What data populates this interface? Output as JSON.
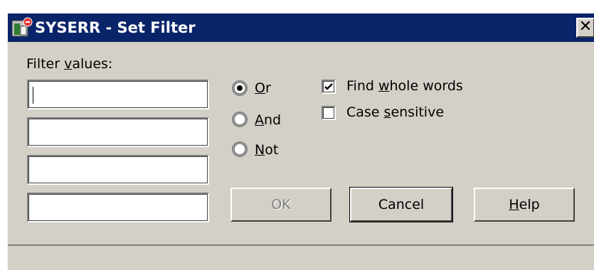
{
  "window": {
    "title": "SYSERR - Set Filter",
    "close_symbol": "✕",
    "icon": "app-icon"
  },
  "filter": {
    "label_prefix": "Filter ",
    "label_access": "v",
    "label_suffix": "alues:",
    "values": [
      "",
      "",
      "",
      ""
    ]
  },
  "logic": {
    "options": [
      {
        "access": "O",
        "rest": "r",
        "checked": true
      },
      {
        "access": "A",
        "rest": "nd",
        "checked": false
      },
      {
        "access": "N",
        "rest": "ot",
        "checked": false
      }
    ]
  },
  "options": {
    "whole_words": {
      "prefix": "Find ",
      "access": "w",
      "suffix": "hole words",
      "checked": true
    },
    "case_sensitive": {
      "prefix": "Case ",
      "access": "s",
      "suffix": "ensitive",
      "checked": false
    }
  },
  "buttons": {
    "ok": "OK",
    "cancel": "Cancel",
    "help_access": "H",
    "help_rest": "elp"
  },
  "status": {
    "text": ""
  }
}
